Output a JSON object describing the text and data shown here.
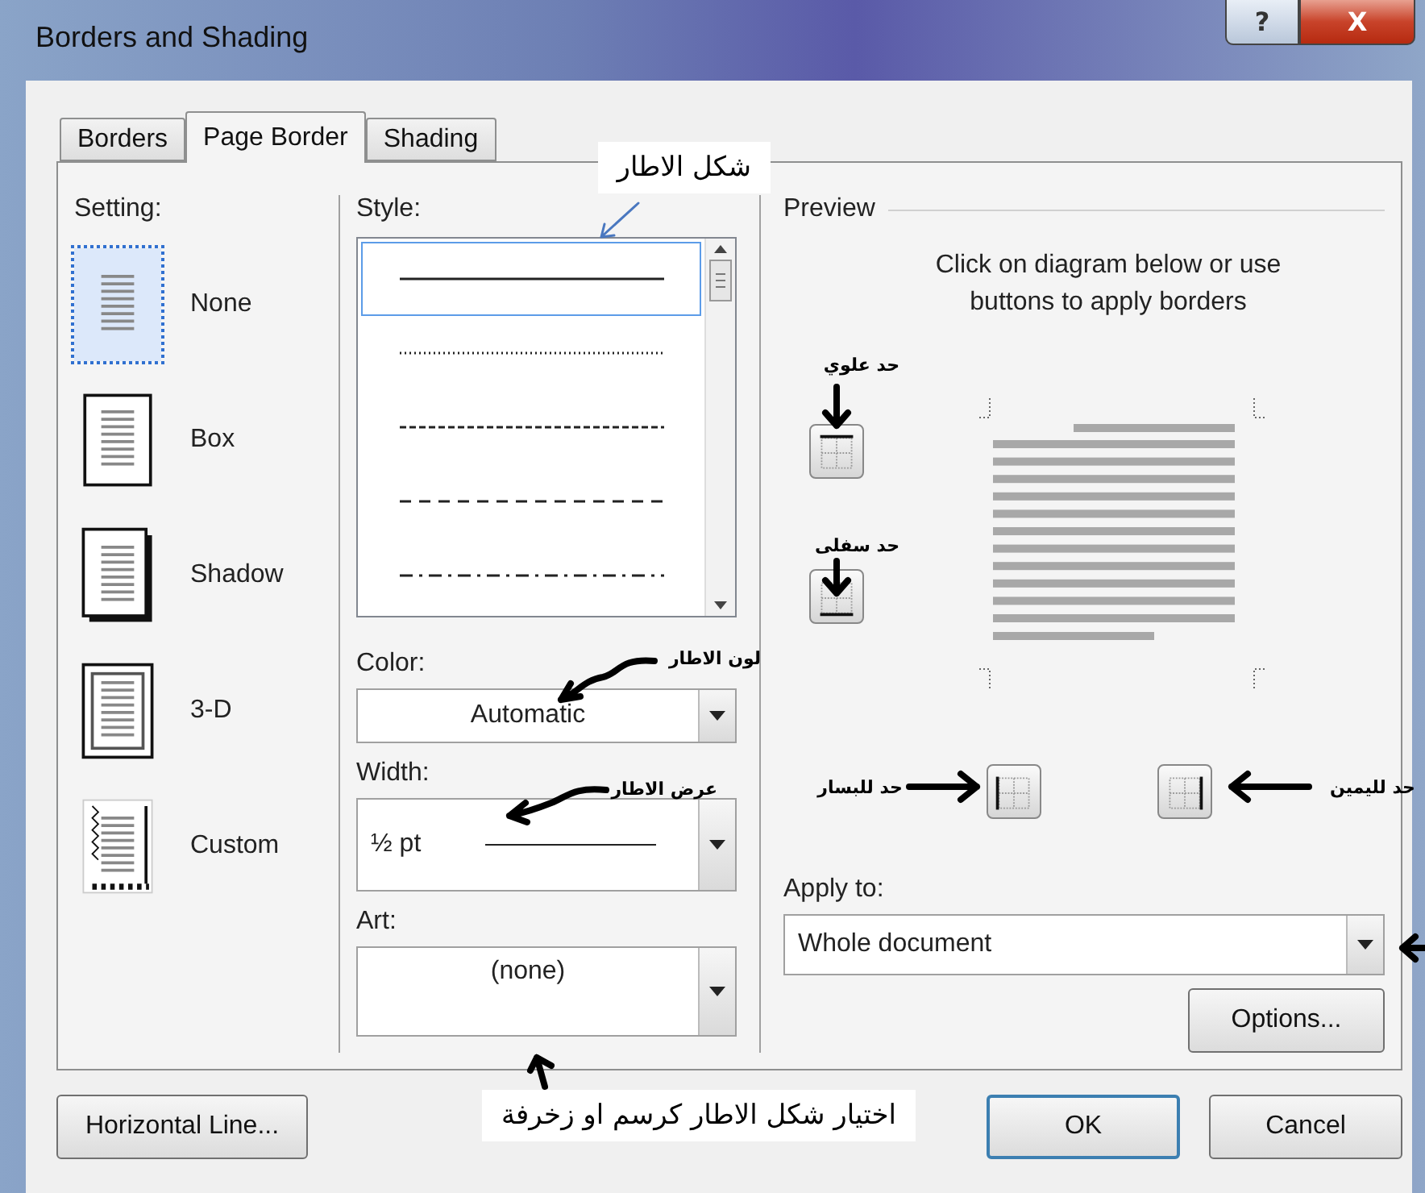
{
  "window": {
    "title": "Borders and Shading",
    "help": "?",
    "close": "X"
  },
  "tabs": [
    {
      "label": "Borders",
      "selected": false
    },
    {
      "label": "Page Border",
      "selected": true
    },
    {
      "label": "Shading",
      "selected": false
    }
  ],
  "setting": {
    "label": "Setting:",
    "options": [
      {
        "label": "None",
        "kind": "none",
        "selected": true
      },
      {
        "label": "Box",
        "kind": "box",
        "selected": false
      },
      {
        "label": "Shadow",
        "kind": "shadow",
        "selected": false
      },
      {
        "label": "3-D",
        "kind": "threed",
        "selected": false
      },
      {
        "label": "Custom",
        "kind": "custom",
        "selected": false
      }
    ]
  },
  "style": {
    "label": "Style:",
    "lines": [
      {
        "kind": "solid",
        "selected": true
      },
      {
        "kind": "dotted",
        "selected": false
      },
      {
        "kind": "dashed",
        "selected": false
      },
      {
        "kind": "longdash",
        "selected": false
      },
      {
        "kind": "dashdot",
        "selected": false
      }
    ]
  },
  "color": {
    "label": "Color:",
    "value": "Automatic"
  },
  "width": {
    "label": "Width:",
    "value": "½ pt"
  },
  "art": {
    "label": "Art:",
    "value": "(none)"
  },
  "preview": {
    "label": "Preview",
    "hint": "Click on diagram below or use buttons to apply borders"
  },
  "apply_to": {
    "label": "Apply to:",
    "value": "Whole document"
  },
  "buttons": {
    "options": "Options...",
    "horizontal_line": "Horizontal Line...",
    "ok": "OK",
    "cancel": "Cancel"
  },
  "annotations": [
    {
      "kind": "style",
      "text": "شكل الاطار"
    },
    {
      "kind": "top",
      "text": "حد علوي"
    },
    {
      "kind": "bottom",
      "text": "حد سفلى"
    },
    {
      "kind": "color",
      "text": "لون الاطار"
    },
    {
      "kind": "right",
      "text": "حد لليمين"
    },
    {
      "kind": "left",
      "text": "حد للبسار"
    },
    {
      "kind": "width",
      "text": "عرض الاطار"
    },
    {
      "kind": "art",
      "text": "اختيار شكل الاطار كرسم او زخرفة"
    }
  ]
}
